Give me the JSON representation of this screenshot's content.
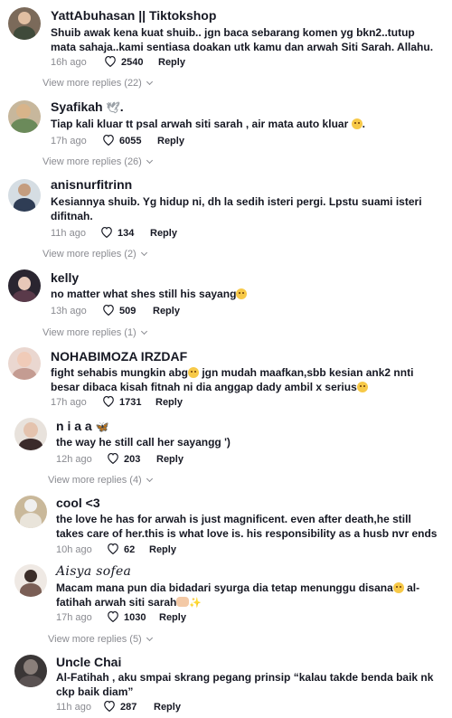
{
  "colors": {
    "text": "#161823",
    "muted": "#8a8b91",
    "background": "#ffffff"
  },
  "comments": [
    {
      "username": "YattAbuhasan || Tiktokshop",
      "line1": "Shuib awak kena kuat shuib.. jgn baca sebarang komen yg bkn2..tutup",
      "line2": "mata sahaja..kami sentiasa doakan utk kamu dan arwah Siti Sarah. Allahu.",
      "time": "16h ago",
      "likes": "2540",
      "reply": "Reply",
      "view_replies": "View more replies (22)"
    },
    {
      "username": "Syafikah",
      "line1": "Tiap kali kluar tt psal arwah siti sarah , air mata auto kluar",
      "time": "17h ago",
      "likes": "6055",
      "reply": "Reply",
      "view_replies": "View more replies (26)"
    },
    {
      "username": "anisnurfitrinn",
      "line1": "Kesiannya shuib. Yg hidup ni, dh la sedih isteri pergi. Lpstu suami isteri",
      "line2": "difitnah.",
      "time": "11h ago",
      "likes": "134",
      "reply": "Reply",
      "view_replies": "View more replies (2)"
    },
    {
      "username": "kelly",
      "line1": "no matter what shes still his sayang",
      "time": "13h ago",
      "likes": "509",
      "reply": "Reply",
      "view_replies": "View more replies (1)"
    },
    {
      "username": "NOHABIMOZA IRZDAF",
      "line1a": "fight sehabis mungkin abg",
      "line1b": " jgn mudah maafkan,sbb kesian ank2 nnti",
      "line2": "besar dibaca kisah fitnah ni dia anggap dady ambil x serius",
      "time": "17h ago",
      "likes": "1731",
      "reply": "Reply"
    },
    {
      "username": "n i a a",
      "line1": "the way he still call her sayangg ')",
      "time": "12h ago",
      "likes": "203",
      "reply": "Reply",
      "view_replies": "View more replies (4)"
    },
    {
      "username": "cool <3",
      "line1": "the love he has for arwah is just magnificent. even after death,he still",
      "line2": "takes care of her.this is what love is. his responsibility as a husb nvr ends",
      "time": "10h ago",
      "likes": "62",
      "reply": "Reply"
    },
    {
      "username": "Aisya sofea",
      "line1": "Macam mana pun dia bidadari syurga dia tetap menunggu disana",
      "line1b": " al-",
      "line2": "fatihah arwah siti sarah",
      "time": "17h ago",
      "likes": "1030",
      "reply": "Reply",
      "view_replies": "View more replies (5)"
    },
    {
      "username": "Uncle Chai",
      "line1": "Al-Fatihah , aku smpai skrang pegang prinsip “kalau takde benda baik nk",
      "line2": "ckp baik diam”",
      "time": "11h ago",
      "likes": "287",
      "reply": "Reply"
    }
  ]
}
